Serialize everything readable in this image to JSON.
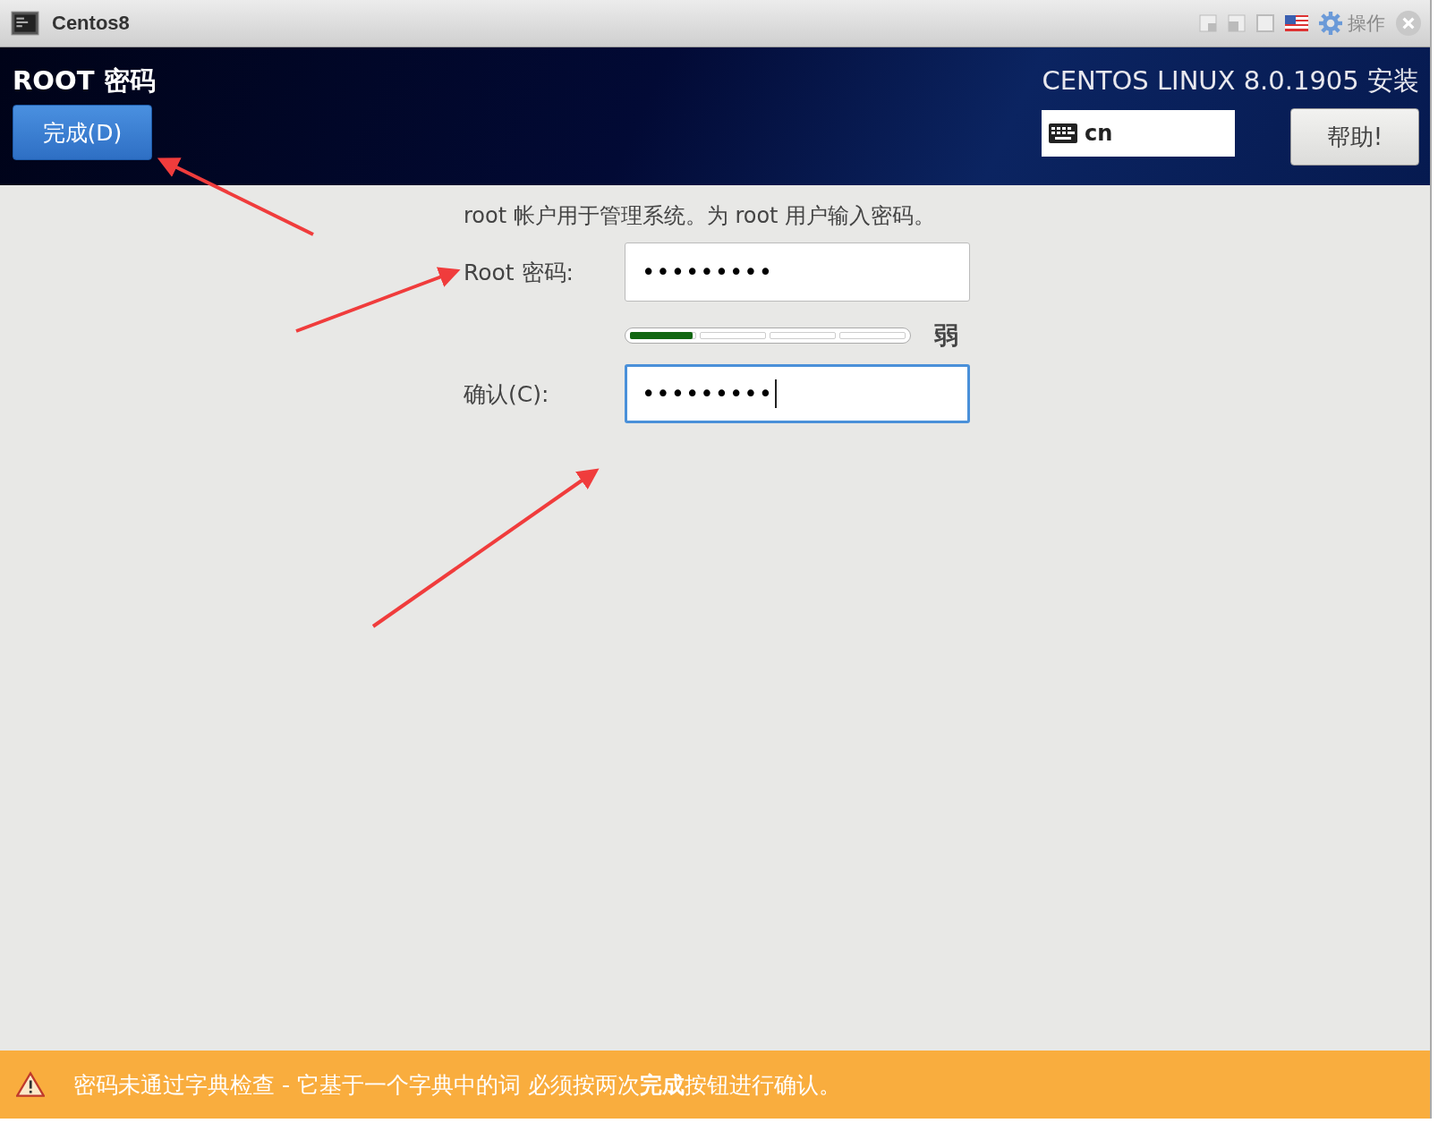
{
  "window": {
    "title": "Centos8",
    "menu_label": "操作"
  },
  "header": {
    "title": "ROOT 密码",
    "done_button": "完成(D)",
    "product": "CENTOS LINUX 8.0.1905 安装",
    "keyboard": "cn",
    "help_button": "帮助!"
  },
  "form": {
    "intro": "root 帐户用于管理系统。为 root 用户输入密码。",
    "fields": [
      {
        "label": "Root 密码:",
        "value": "•••••••••",
        "focused": false
      },
      {
        "label": "确认(C):",
        "value": "•••••••••",
        "focused": true
      }
    ],
    "strength": {
      "level": 0.25,
      "label": "弱"
    }
  },
  "warning": {
    "text": "密码未通过字典检查 - 它基于一个字典中的词 必须按两次**完成**按钮进行确认。"
  }
}
